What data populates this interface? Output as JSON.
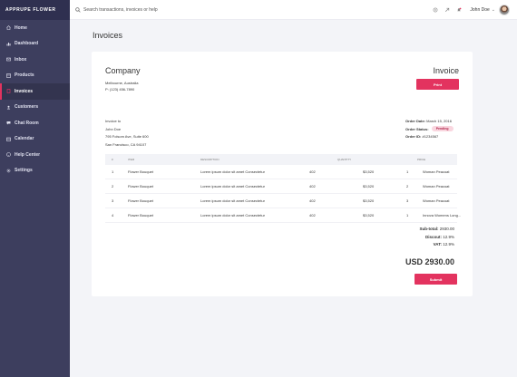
{
  "brand": "APPRUPE FLOWER",
  "sidebar": {
    "items": [
      {
        "label": "Home",
        "icon": "home-icon"
      },
      {
        "label": "Dashboard",
        "icon": "dashboard-icon"
      },
      {
        "label": "Inbox",
        "icon": "inbox-icon"
      },
      {
        "label": "Products",
        "icon": "products-icon"
      },
      {
        "label": "Invoices",
        "icon": "invoice-icon",
        "active": true
      },
      {
        "label": "Customers",
        "icon": "customers-icon"
      },
      {
        "label": "Chat Room",
        "icon": "chat-icon"
      },
      {
        "label": "Calendar",
        "icon": "calendar-icon"
      },
      {
        "label": "Help Center",
        "icon": "help-icon"
      },
      {
        "label": "Settings",
        "icon": "settings-icon"
      }
    ]
  },
  "topbar": {
    "search_placeholder": "Search transactions, invoices or help",
    "user_name": "John Doe",
    "user_caret": "⌄"
  },
  "page": {
    "title": "Invoices"
  },
  "invoice": {
    "company": "Company",
    "heading": "Invoice",
    "address_line1": "Melbourne, Australia",
    "address_line2": "P: (123) 456-7890",
    "print_label": "Print",
    "bill_to": {
      "label": "Invoice to",
      "name": "John Doe",
      "street": "795 Folsom Ave, Suite 600",
      "city": "San Francisco, CA 94107"
    },
    "order": {
      "date_label": "Order Date:",
      "date": "March 15, 2016",
      "status_label": "Order Status:",
      "status": "Pending",
      "id_label": "Order ID:",
      "id": "#1234567"
    },
    "table": {
      "headers": [
        "#",
        "ITEM",
        "DESCRIPTION",
        "QUANTITY",
        "PRICE"
      ],
      "rows": [
        [
          "1",
          "Flower Bouquet",
          "Lorem ipsum dolor sit amet Consectetur",
          "402",
          "$3,520",
          "1",
          "Woman Peacoat"
        ],
        [
          "2",
          "Flower Bouquet",
          "Lorem ipsum dolor sit amet Consectetur",
          "402",
          "$3,520",
          "2",
          "Woman Peacoat"
        ],
        [
          "3",
          "Flower Bouquet",
          "Lorem ipsum dolor sit amet Consectetur",
          "402",
          "$3,520",
          "3",
          "Woman Peacoat"
        ],
        [
          "4",
          "Flower Bouquet",
          "Lorem ipsum dolor sit amet Consectetur",
          "402",
          "$3,520",
          "1",
          "Innova Womens Long..."
        ]
      ]
    },
    "subtotal_label": "Sub-total:",
    "subtotal": "2930.00",
    "discount_label": "Discout:",
    "discount": "12.9%",
    "vat_label": "VAT:",
    "vat": "12.9%",
    "total": "USD 2930.00",
    "submit_label": "Submit"
  },
  "colors": {
    "accent": "#e3335f",
    "sidebar": "#3d3e5e",
    "sidebar_dark": "#2f3050"
  }
}
